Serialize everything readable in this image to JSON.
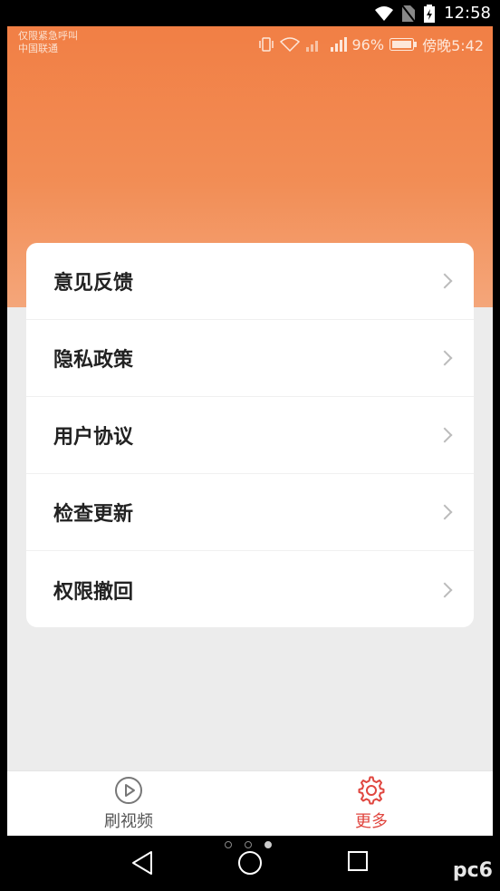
{
  "device_status": {
    "time": "12:58"
  },
  "app_status": {
    "carrier_line1": "仅限紧急呼叫",
    "carrier_line2": "中国联通",
    "battery": "96%",
    "time": "傍晚5:42"
  },
  "menu": {
    "items": [
      {
        "label": "意见反馈"
      },
      {
        "label": "隐私政策"
      },
      {
        "label": "用户协议"
      },
      {
        "label": "检查更新"
      },
      {
        "label": "权限撤回"
      }
    ]
  },
  "tabbar": {
    "tabs": [
      {
        "label": "刷视频",
        "icon": "play-circle-icon",
        "active": false
      },
      {
        "label": "更多",
        "icon": "gear-icon",
        "active": true
      }
    ],
    "active_color": "#e0463f",
    "inactive_color": "#555555"
  },
  "watermark": "pc6"
}
